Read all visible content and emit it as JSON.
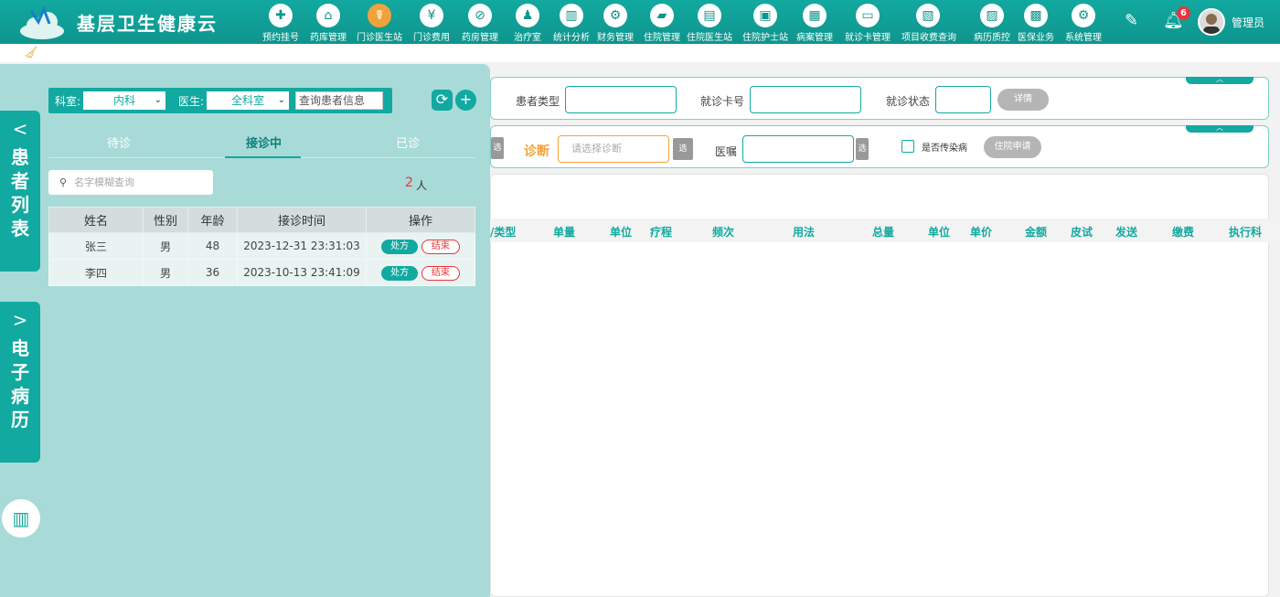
{
  "header": {
    "app_title": "基层卫生健康云",
    "user_name": "管理员",
    "notification_count": "6",
    "nav": [
      {
        "label": "预约挂号",
        "icon": "calendar-plus-icon",
        "glyph": "✚"
      },
      {
        "label": "药库管理",
        "icon": "warehouse-icon",
        "glyph": "⌂"
      },
      {
        "label": "门诊医生站",
        "icon": "doctor-icon",
        "glyph": "☤",
        "active": true
      },
      {
        "label": "门诊费用",
        "icon": "yuan-icon",
        "glyph": "¥"
      },
      {
        "label": "药房管理",
        "icon": "pill-icon",
        "glyph": "⊘"
      },
      {
        "label": "治疗室",
        "icon": "nurse-icon",
        "glyph": "♟"
      },
      {
        "label": "统计分析",
        "icon": "chart-icon",
        "glyph": "▥"
      },
      {
        "label": "财务管理",
        "icon": "gear-money-icon",
        "glyph": "⚙"
      },
      {
        "label": "住院管理",
        "icon": "bed-icon",
        "glyph": "▰"
      },
      {
        "label": "住院医生站",
        "icon": "doctor-card-icon",
        "glyph": "▤"
      },
      {
        "label": "住院护士站",
        "icon": "nurse-card-icon",
        "glyph": "▣"
      },
      {
        "label": "病案管理",
        "icon": "record-icon",
        "glyph": "▦"
      },
      {
        "label": "就诊卡管理",
        "icon": "card-icon",
        "glyph": "▭"
      },
      {
        "label": "项目收费查询",
        "icon": "fee-doc-icon",
        "glyph": "▧"
      },
      {
        "label": "病历质控",
        "icon": "clipboard-icon",
        "glyph": "▨"
      },
      {
        "label": "医保业务",
        "icon": "insurance-card-icon",
        "glyph": "▩"
      },
      {
        "label": "系统管理",
        "icon": "settings-icon",
        "glyph": "⚙"
      }
    ]
  },
  "side_tabs": {
    "patient_list": "患者列表",
    "emr": "电子病历"
  },
  "filter": {
    "dept_label": "科室:",
    "dept_value": "内科",
    "doctor_label": "医生:",
    "doctor_value": "全科室",
    "patient_query_placeholder": "查询患者信息"
  },
  "tabs": {
    "waiting": "待诊",
    "in_progress": "接诊中",
    "done": "已诊"
  },
  "search": {
    "placeholder": "名字模糊查询"
  },
  "count": {
    "value": "2",
    "unit": "人"
  },
  "patient_table": {
    "columns": [
      "姓名",
      "性别",
      "年龄",
      "接诊时间",
      "操作"
    ],
    "rows": [
      {
        "name": "张三",
        "gender": "男",
        "age": "48",
        "time": "2023-12-31 23:31:03",
        "rx": "处方",
        "end": "结束"
      },
      {
        "name": "李四",
        "gender": "男",
        "age": "36",
        "time": "2023-10-13 23:41:09",
        "rx": "处方",
        "end": "结束"
      }
    ]
  },
  "form": {
    "patient_type_label": "患者类型",
    "card_no_label": "就诊卡号",
    "visit_status_label": "就诊状态",
    "detail_button": "详情",
    "select_short": "选",
    "diagnosis_label": "诊断",
    "diagnosis_placeholder": "请选择诊断",
    "advice_label": "医嘱",
    "infectious_label": "是否传染病",
    "hospitalize_button": "住院申请"
  },
  "order_table": {
    "columns": [
      "/类型",
      "单量",
      "单位",
      "疗程",
      "频次",
      "用法",
      "总量",
      "单位",
      "单价",
      "金额",
      "皮试",
      "发送",
      "缴费",
      "执行科"
    ]
  },
  "colors": {
    "primary": "#12a9a0",
    "panel_bg": "#a8dbd7",
    "accent_orange": "#f2a23a",
    "alert_red": "#e8353b"
  }
}
